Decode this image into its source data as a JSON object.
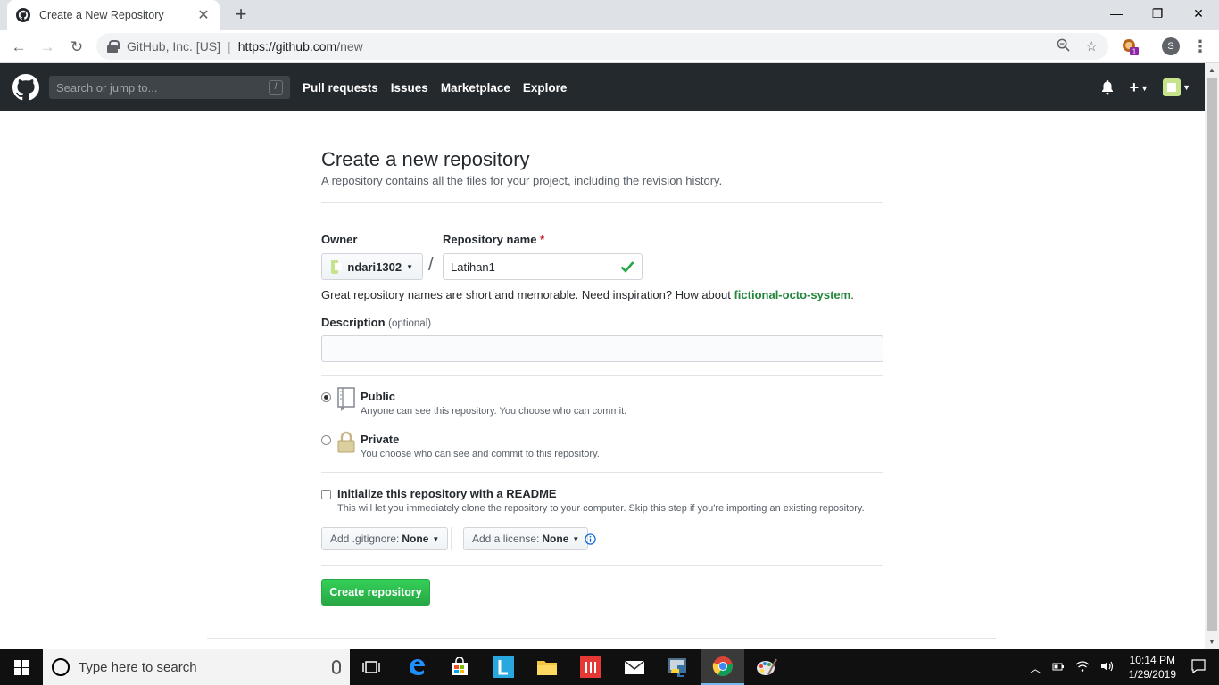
{
  "browser": {
    "tab_title": "Create a New Repository",
    "site_identity": "GitHub, Inc. [US]",
    "url_host": "https://github.com",
    "url_path": "/new",
    "profile_initial": "S",
    "extension_badge": "1"
  },
  "github_header": {
    "search_placeholder": "Search or jump to...",
    "search_shortcut": "/",
    "nav": [
      "Pull requests",
      "Issues",
      "Marketplace",
      "Explore"
    ]
  },
  "form": {
    "title": "Create a new repository",
    "subtitle": "A repository contains all the files for your project, including the revision history.",
    "owner_label": "Owner",
    "owner_value": "ndari1302",
    "repo_name_label": "Repository name",
    "repo_name_required": "*",
    "repo_name_value": "Latihan1",
    "hint_prefix": "Great repository names are short and memorable. Need inspiration? How about ",
    "hint_suggestion": "fictional-octo-system",
    "hint_suffix": ".",
    "description_label": "Description",
    "description_optional": "(optional)",
    "description_value": "",
    "visibility": {
      "selected": "Public",
      "public_title": "Public",
      "public_note": "Anyone can see this repository. You choose who can commit.",
      "private_title": "Private",
      "private_note": "You choose who can see and commit to this repository."
    },
    "readme_title": "Initialize this repository with a README",
    "readme_note": "This will let you immediately clone the repository to your computer. Skip this step if you're importing an existing repository.",
    "readme_checked": false,
    "gitignore_label": "Add .gitignore:",
    "gitignore_value": "None",
    "license_label": "Add a license:",
    "license_value": "None",
    "submit_label": "Create repository"
  },
  "taskbar": {
    "search_placeholder": "Type here to search",
    "time": "10:14 PM",
    "date": "1/29/2019"
  },
  "colors": {
    "github_header_bg": "#24292e",
    "primary_button": "#28a745",
    "suggestion_link": "#22863a",
    "taskbar_bg": "#101010"
  }
}
